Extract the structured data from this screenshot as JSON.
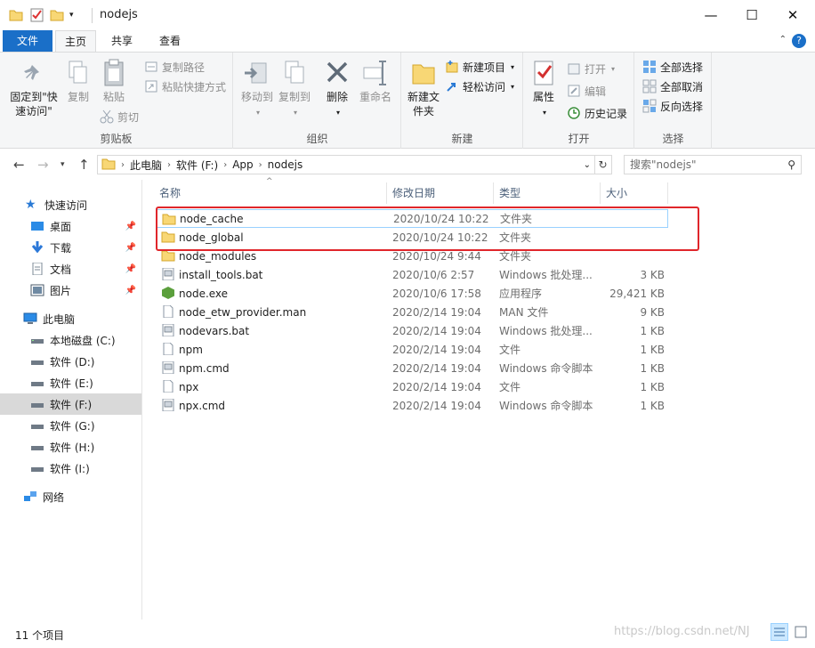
{
  "window": {
    "title": "nodejs",
    "minimize": "—",
    "maximize": "☐",
    "close": "✕"
  },
  "ribbon_tabs": [
    {
      "label": "文件"
    },
    {
      "label": "主页"
    },
    {
      "label": "共享"
    },
    {
      "label": "查看"
    }
  ],
  "help": "?",
  "ribbon": {
    "clipboard": {
      "pin_label": "固定到\"快速访问\"",
      "copy_label": "复制",
      "paste_label": "粘贴",
      "copy_path": "复制路径",
      "paste_shortcut": "粘贴快捷方式",
      "cut": "剪切",
      "group_label": "剪贴板"
    },
    "organize": {
      "move_to": "移动到",
      "copy_to": "复制到",
      "delete": "删除",
      "rename": "重命名",
      "group_label": "组织"
    },
    "new": {
      "new_folder": "新建文件夹",
      "new_item": "新建项目",
      "easy_access": "轻松访问",
      "group_label": "新建"
    },
    "open": {
      "properties": "属性",
      "open": "打开",
      "edit": "编辑",
      "history": "历史记录",
      "group_label": "打开"
    },
    "select": {
      "select_all": "全部选择",
      "select_none": "全部取消",
      "invert": "反向选择",
      "group_label": "选择"
    }
  },
  "address": {
    "crumbs": [
      "此电脑",
      "软件 (F:)",
      "App",
      "nodejs"
    ],
    "search_placeholder": "搜索\"nodejs\""
  },
  "nav": {
    "quick_access": "快速访问",
    "quick_items": [
      "桌面",
      "下载",
      "文档",
      "图片"
    ],
    "this_pc": "此电脑",
    "drives": [
      "本地磁盘 (C:)",
      "软件 (D:)",
      "软件 (E:)",
      "软件 (F:)",
      "软件 (G:)",
      "软件 (H:)",
      "软件 (I:)"
    ],
    "network": "网络"
  },
  "columns": {
    "name": "名称",
    "date": "修改日期",
    "type": "类型",
    "size": "大小"
  },
  "files": [
    {
      "name": "node_cache",
      "date": "2020/10/24 10:22",
      "type": "文件夹",
      "size": "",
      "icon": "folder-icon"
    },
    {
      "name": "node_global",
      "date": "2020/10/24 10:22",
      "type": "文件夹",
      "size": "",
      "icon": "folder-icon"
    },
    {
      "name": "node_modules",
      "date": "2020/10/24 9:44",
      "type": "文件夹",
      "size": "",
      "icon": "folder-icon"
    },
    {
      "name": "install_tools.bat",
      "date": "2020/10/6 2:57",
      "type": "Windows 批处理...",
      "size": "3 KB",
      "icon": "batch-file-icon"
    },
    {
      "name": "node.exe",
      "date": "2020/10/6 17:58",
      "type": "应用程序",
      "size": "29,421 KB",
      "icon": "node-exe-icon"
    },
    {
      "name": "node_etw_provider.man",
      "date": "2020/2/14 19:04",
      "type": "MAN 文件",
      "size": "9 KB",
      "icon": "file-icon"
    },
    {
      "name": "nodevars.bat",
      "date": "2020/2/14 19:04",
      "type": "Windows 批处理...",
      "size": "1 KB",
      "icon": "batch-file-icon"
    },
    {
      "name": "npm",
      "date": "2020/2/14 19:04",
      "type": "文件",
      "size": "1 KB",
      "icon": "file-icon"
    },
    {
      "name": "npm.cmd",
      "date": "2020/2/14 19:04",
      "type": "Windows 命令脚本",
      "size": "1 KB",
      "icon": "batch-file-icon"
    },
    {
      "name": "npx",
      "date": "2020/2/14 19:04",
      "type": "文件",
      "size": "1 KB",
      "icon": "file-icon"
    },
    {
      "name": "npx.cmd",
      "date": "2020/2/14 19:04",
      "type": "Windows 命令脚本",
      "size": "1 KB",
      "icon": "batch-file-icon"
    }
  ],
  "status": {
    "count": "11 个项目"
  },
  "watermark": "https://blog.csdn.net/NJ",
  "colors": {
    "accent": "#1a6fc8",
    "highlight_border": "#e0262b",
    "folder": "#f8d775"
  }
}
